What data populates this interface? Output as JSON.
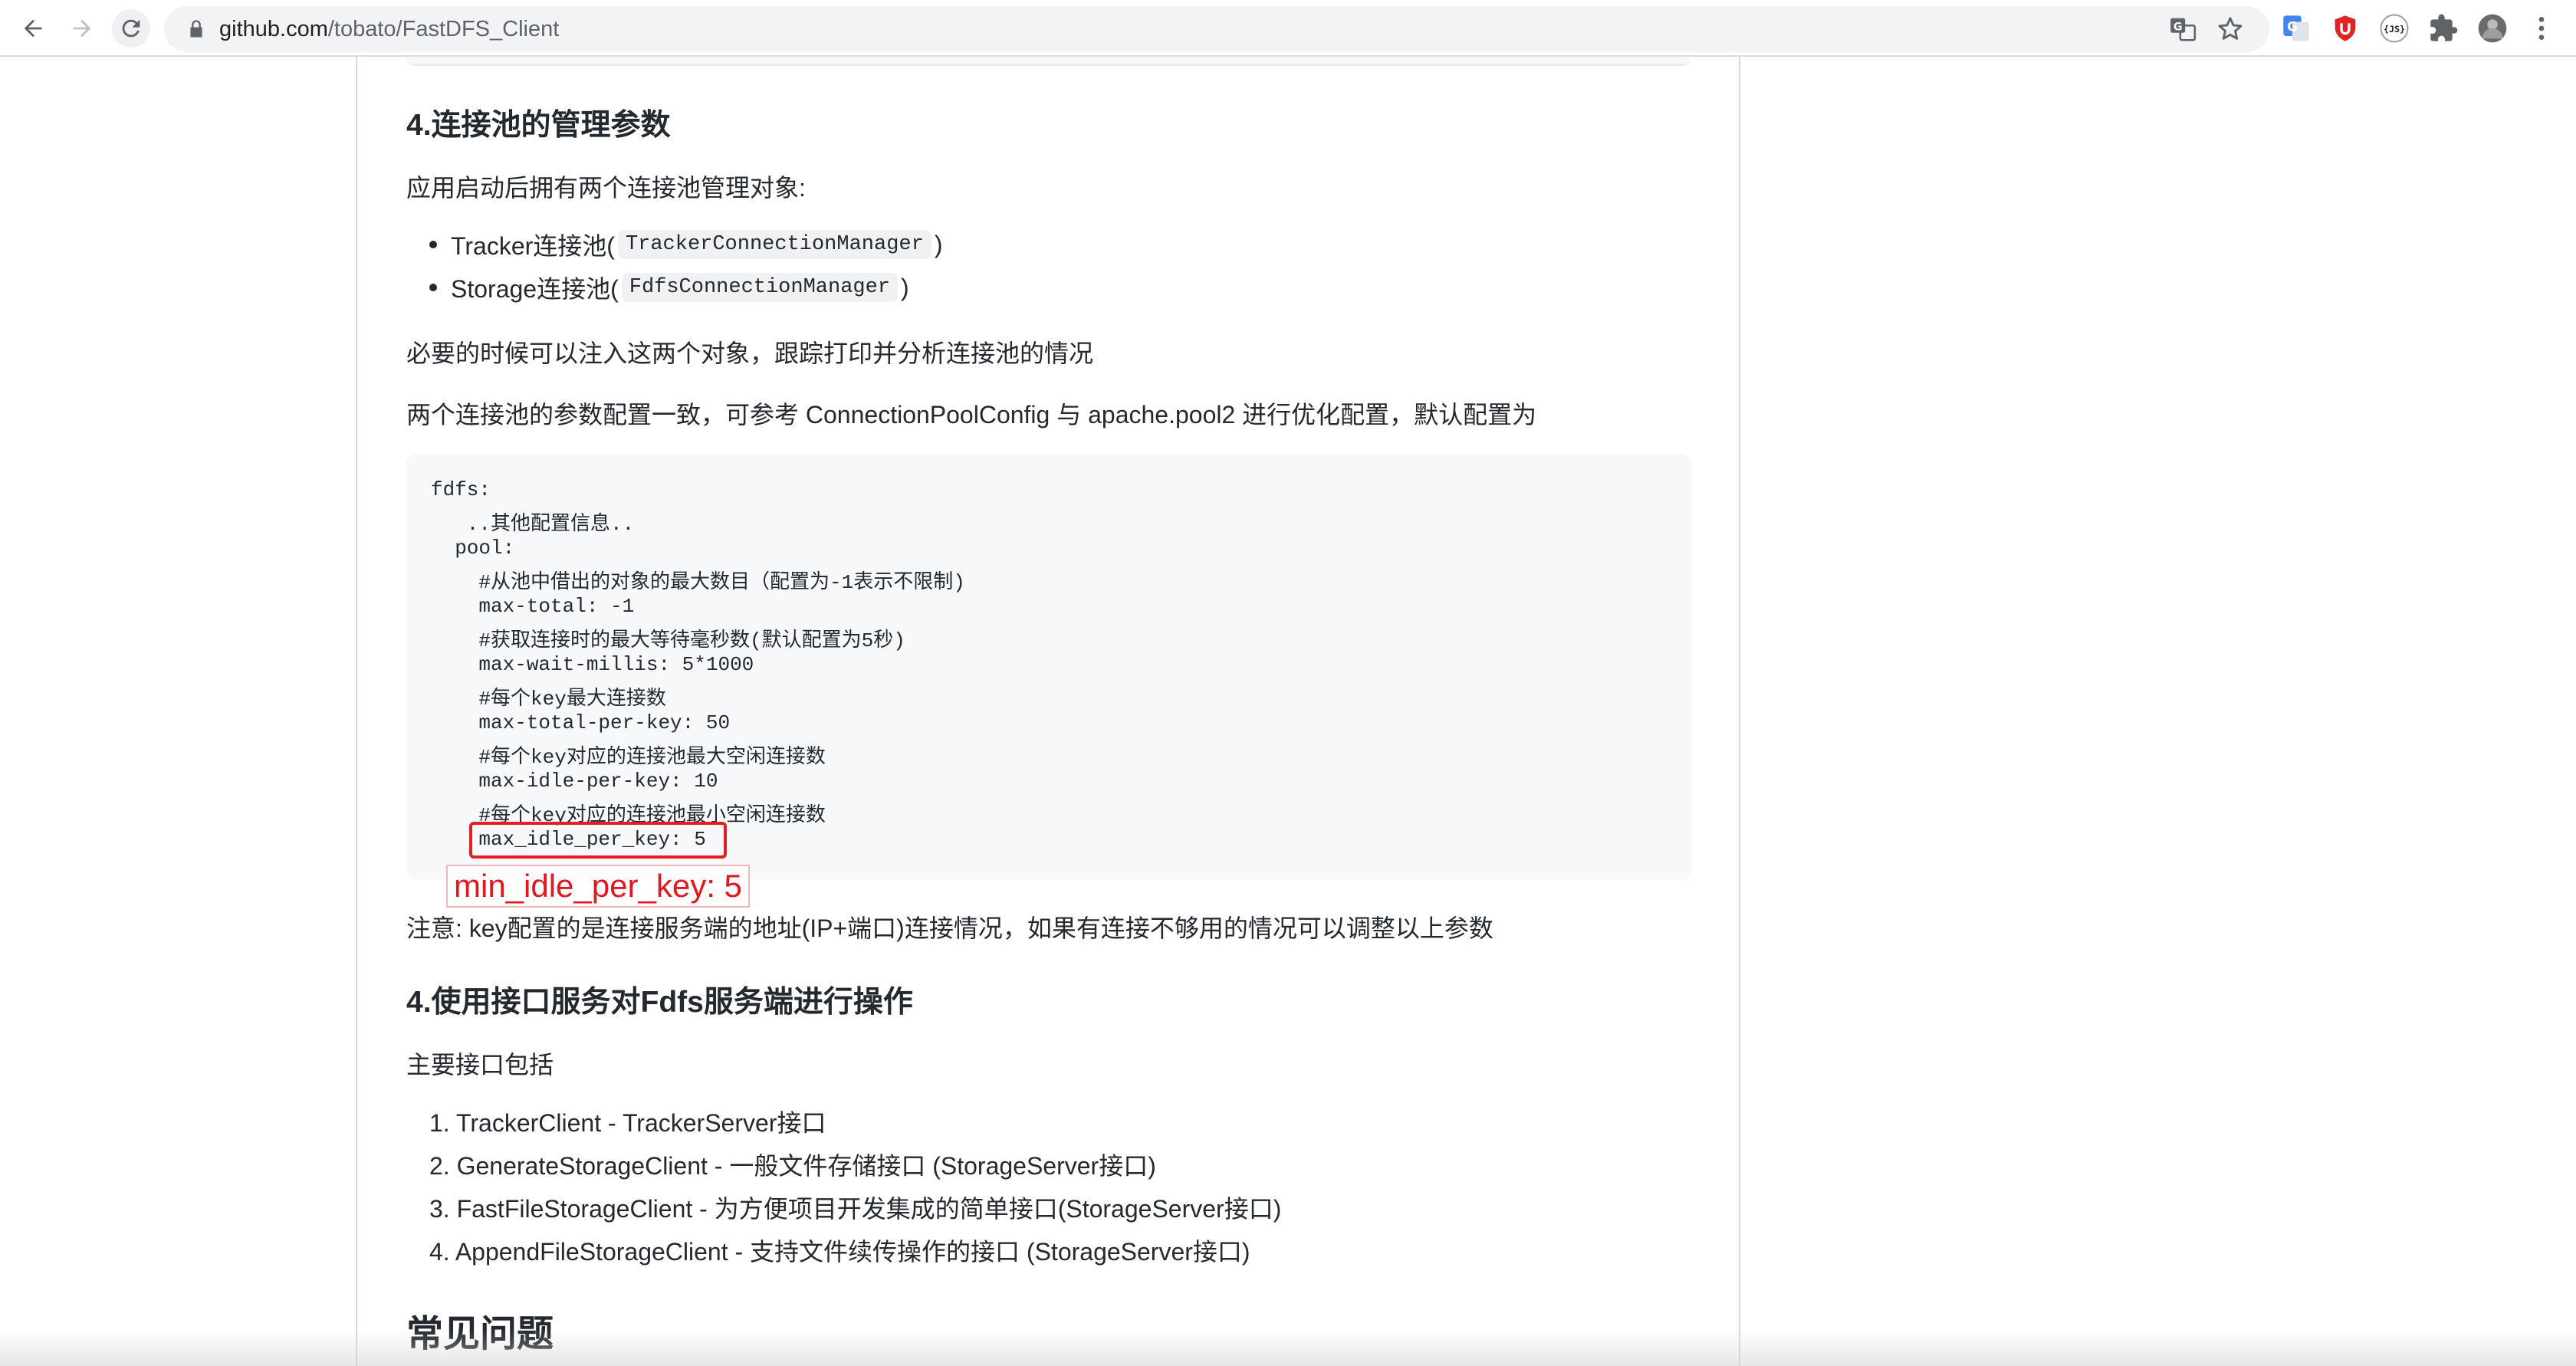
{
  "browser": {
    "url_host": "github.com",
    "url_path": "/tobato/FastDFS_Client",
    "icons": [
      "back-icon",
      "forward-icon",
      "reload-icon",
      "lock-icon",
      "translate-icon",
      "star-icon",
      "google-translate-icon",
      "ublock-icon",
      "json-viewer-icon",
      "extensions-icon",
      "profile-avatar",
      "menu-icon"
    ],
    "json_ext_label": "{JS}"
  },
  "content": {
    "section_pool_title": "4.连接池的管理参数",
    "intro": "应用启动后拥有两个连接池管理对象:",
    "bullets": [
      {
        "text": "Tracker连接池(",
        "code": "TrackerConnectionManager",
        "tail": ")"
      },
      {
        "text": "Storage连接池(",
        "code": "FdfsConnectionManager",
        "tail": ")"
      }
    ],
    "inject_text": "必要的时候可以注入这两个对象，跟踪打印并分析连接池的情况",
    "config_text": "两个连接池的参数配置一致，可参考 ConnectionPoolConfig 与 apache.pool2 进行优化配置，默认配置为",
    "code_lines": [
      "fdfs:",
      "   ..其他配置信息..",
      "  pool:",
      "    #从池中借出的对象的最大数目（配置为-1表示不限制)",
      "    max-total: -1",
      "    #获取连接时的最大等待毫秒数(默认配置为5秒)",
      "    max-wait-millis: 5*1000",
      "    #每个key最大连接数",
      "    max-total-per-key: 50",
      "    #每个key对应的连接池最大空闲连接数",
      "    max-idle-per-key: 10",
      "    #每个key对应的连接池最小空闲连接数",
      "    max_idle_per_key: 5"
    ],
    "annotation": "min_idle_per_key: 5",
    "note_text": "注意: key配置的是连接服务端的地址(IP+端口)连接情况，如果有连接不够用的情况可以调整以上参数",
    "section_api_title": "4.使用接口服务对Fdfs服务端进行操作",
    "api_intro": "主要接口包括",
    "api_list": [
      "1. TrackerClient - TrackerServer接口",
      "2. GenerateStorageClient - 一般文件存储接口 (StorageServer接口)",
      "3. FastFileStorageClient - 为方便项目开发集成的简单接口(StorageServer接口)",
      "4. AppendFileStorageClient - 支持文件续传操作的接口 (StorageServer接口)"
    ],
    "faq_title": "常见问题"
  },
  "colors": {
    "annotation": "#e4161f",
    "code_bg": "#f6f8fa",
    "text": "#24292f"
  }
}
